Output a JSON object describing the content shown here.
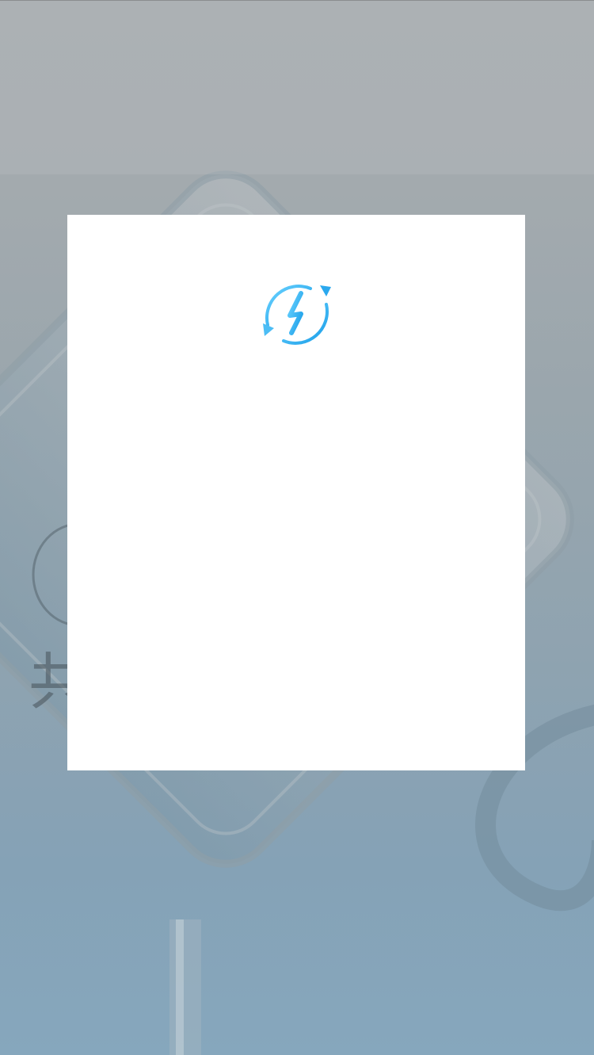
{
  "background": {
    "partial_character": "共"
  },
  "modal": {
    "icon": "charging-refresh-icon",
    "accent_color": "#29a9ee"
  }
}
